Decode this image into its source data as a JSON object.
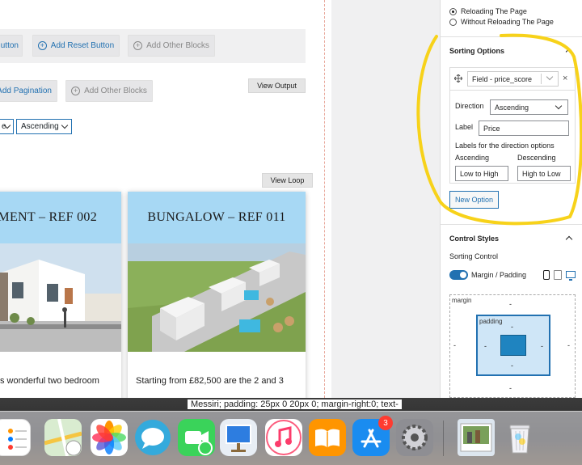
{
  "canvas": {
    "row1": {
      "reset_fragment": "utton",
      "add_reset": "Add Reset Button",
      "add_other": "Add Other Blocks"
    },
    "row2": {
      "add_pagination": "Add Pagination",
      "add_other": "Add Other Blocks",
      "view_output": "View Output"
    },
    "sorting_preview": {
      "left_fragment": "e",
      "order": "Ascending"
    },
    "view_loop": "View Loop",
    "cards": [
      {
        "title": "TMENT – REF 002",
        "text": "s wonderful two bedroom"
      },
      {
        "title": "BUNGALOW – REF 011",
        "text": "Starting from £82,500 are the 2 and 3"
      }
    ]
  },
  "panel": {
    "reload_options": [
      "Reloading The Page",
      "Without Reloading The Page"
    ],
    "sorting": {
      "heading": "Sorting Options",
      "field_select": "Field - price_score",
      "close": "×",
      "direction_label": "Direction",
      "direction_value": "Ascending",
      "label_label": "Label",
      "label_value": "Price",
      "dir_opts_label": "Labels for the direction options",
      "ascending_label": "Ascending",
      "descending_label": "Descending",
      "asc_value": "Low to High",
      "desc_value": "High to Low",
      "new_option": "New Option"
    },
    "control_styles": {
      "heading": "Control Styles",
      "sorting_control": "Sorting Control",
      "margin_padding": "Margin / Padding",
      "margin": "margin",
      "padding": "padding",
      "dash": "-"
    }
  },
  "dock": {
    "tooltip": "Messiri; padding: 25px 0 20px 0;  margin-right:0; text-",
    "badge": "3"
  },
  "colors": {
    "accent": "#2271b1",
    "card_header": "#a7d8f4",
    "annotation": "#f7d21a"
  }
}
